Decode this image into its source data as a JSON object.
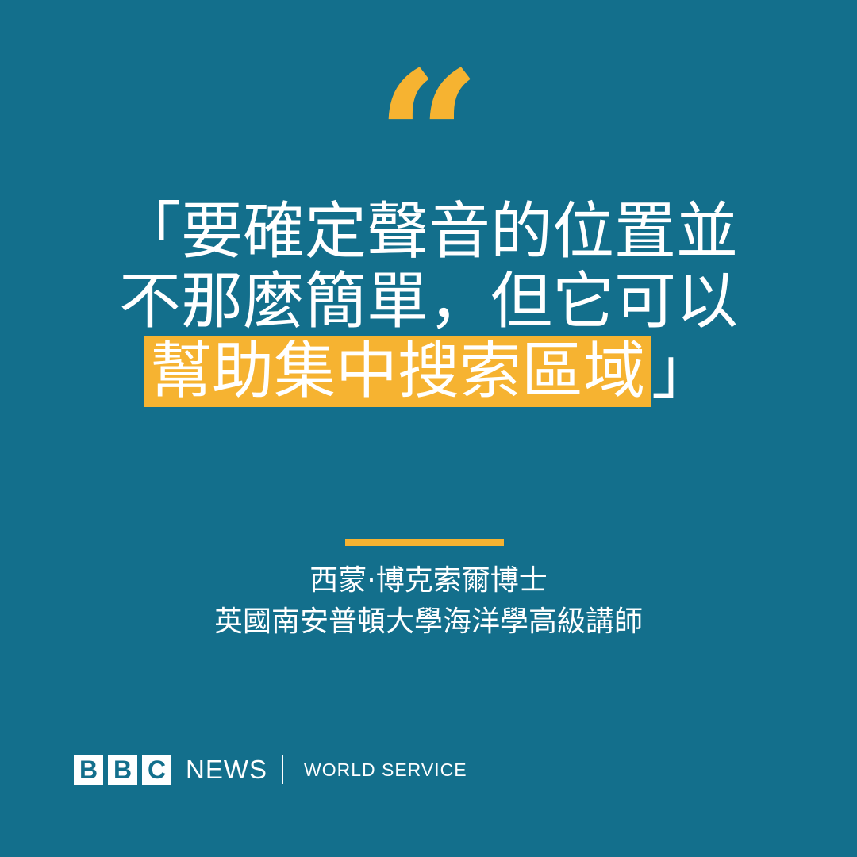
{
  "colors": {
    "background": "#136f8c",
    "accent": "#f6b331",
    "text": "#ffffff",
    "logo_letter": "#136f8c"
  },
  "quote_mark": "“",
  "quote": {
    "line1": "「要確定聲音的位置並",
    "line2": "不那麼簡單，但它可以",
    "line3_highlight": "幫助集中搜索區域",
    "line3_close": "」"
  },
  "attribution": {
    "name": "西蒙·博克索爾博士",
    "title": "英國南安普頓大學海洋學高級講師"
  },
  "branding": {
    "letters": [
      "B",
      "B",
      "C"
    ],
    "news": "NEWS",
    "service": "WORLD SERVICE"
  }
}
